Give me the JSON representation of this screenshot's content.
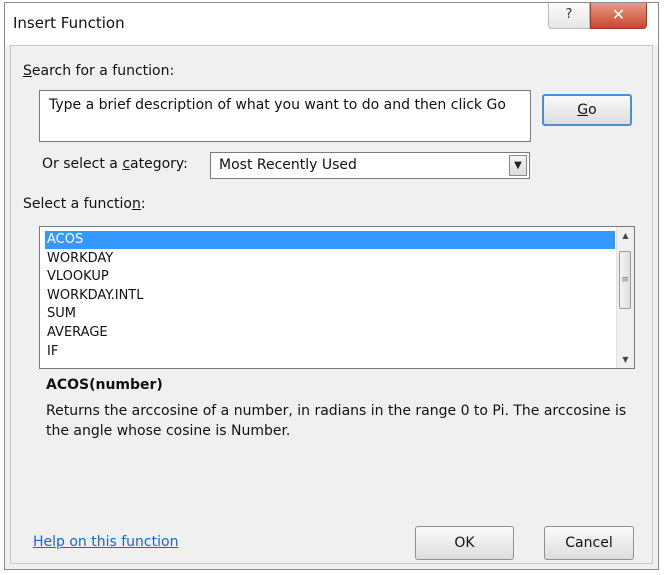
{
  "window": {
    "title": "Insert Function",
    "help_glyph": "?",
    "close_glyph": "✕"
  },
  "search": {
    "label": "Search for a function:",
    "value": "Type a brief description of what you want to do and then click Go",
    "go_label": "Go"
  },
  "category": {
    "label": "Or select a category:",
    "selected": "Most Recently Used"
  },
  "functions": {
    "label": "Select a function:",
    "items": [
      "ACOS",
      "WORKDAY",
      "VLOOKUP",
      "WORKDAY.INTL",
      "SUM",
      "AVERAGE",
      "IF"
    ],
    "selected": "ACOS"
  },
  "details": {
    "syntax": "ACOS(number)",
    "description": "Returns the arccosine of a number, in radians in the range 0 to Pi. The arccosine is the angle whose cosine is Number."
  },
  "footer": {
    "help_link": "Help on this function",
    "ok_label": "OK",
    "cancel_label": "Cancel"
  },
  "colors": {
    "selection": "#3399ff",
    "link": "#1a66c9",
    "close_button": "#c9462c"
  },
  "icons": {
    "help": "question-icon",
    "close": "close-icon",
    "dropdown": "chevron-down-icon",
    "scroll_up": "scroll-up-arrow-icon",
    "scroll_down": "scroll-down-arrow-icon"
  }
}
